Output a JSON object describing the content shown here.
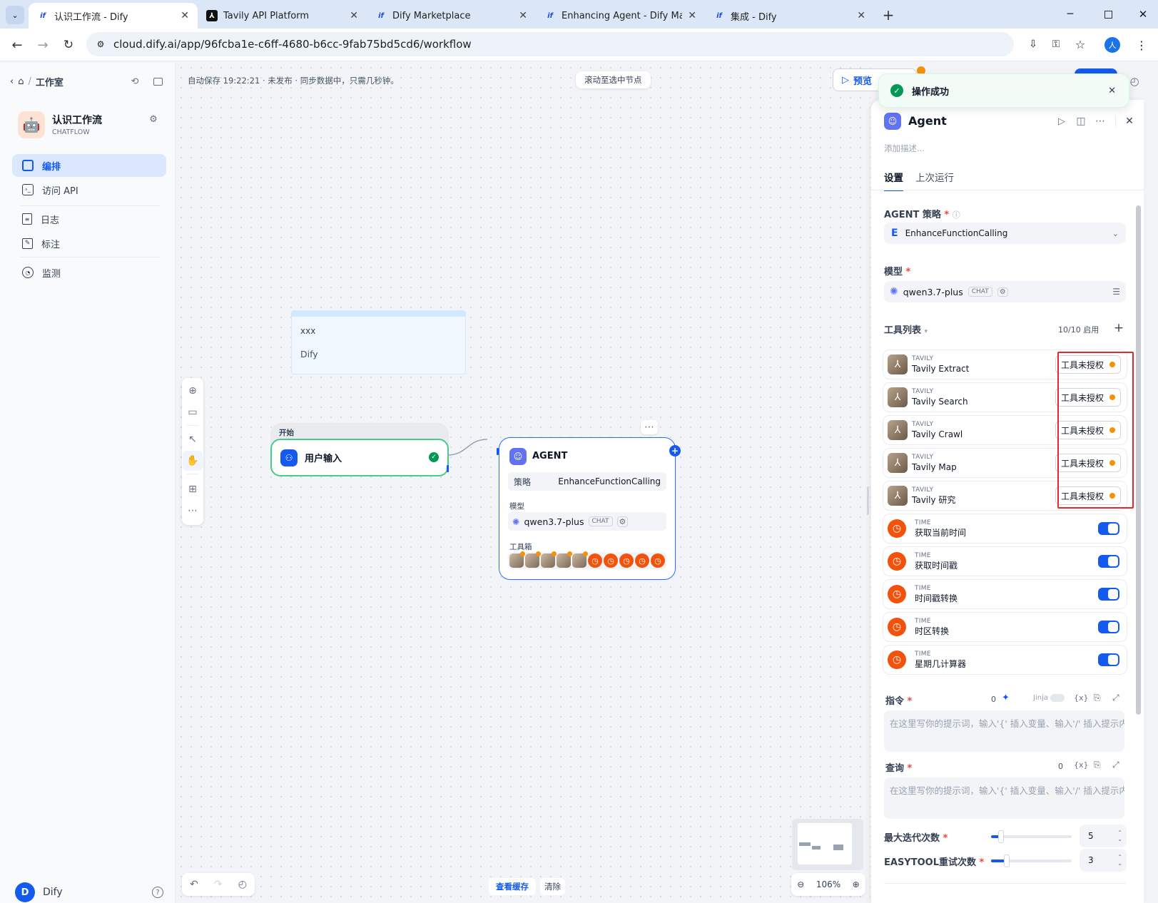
{
  "browser": {
    "tabs": [
      {
        "title": "认识工作流 - Dify",
        "favicon": "dify-icon"
      },
      {
        "title": "Tavily API Platform",
        "favicon": "tavily-icon"
      },
      {
        "title": "Dify Marketplace",
        "favicon": "dify-icon"
      },
      {
        "title": "Enhancing Agent - Dify Mark",
        "favicon": "dify-icon"
      },
      {
        "title": "集成 - Dify",
        "favicon": "dify-icon"
      }
    ],
    "url": "cloud.dify.ai/app/96fcba1e-c6ff-4680-b6cc-9fab75bd5cd6/workflow",
    "profile_initial": "人"
  },
  "sidebar": {
    "breadcrumb": "工作室",
    "app_name": "认识工作流",
    "app_type": "CHATFLOW",
    "nav": [
      {
        "label": "编排",
        "icon": "orchestrate-icon"
      },
      {
        "label": "访问 API",
        "icon": "terminal-icon"
      },
      {
        "label": "日志",
        "icon": "log-icon"
      },
      {
        "label": "标注",
        "icon": "annotation-icon"
      },
      {
        "label": "监测",
        "icon": "monitor-icon"
      }
    ],
    "user_initial": "D",
    "user_name": "Dify"
  },
  "canvas": {
    "status": "自动保存 19:22:21 · 未发布 · 同步数据中，只需几秒钟。",
    "scroll_btn": "滚动至选中节点",
    "preview_btn": "预览",
    "note": {
      "line1": "xxx",
      "line2": "Dify"
    },
    "start_node": {
      "header": "开始",
      "title": "用户输入"
    },
    "agent_node": {
      "title": "AGENT",
      "strategy_label": "策略",
      "strategy_value": "EnhanceFunctionCalling",
      "model_label": "模型",
      "model_value": "qwen3.7-plus",
      "model_badge": "CHAT",
      "tools_label": "工具箱"
    },
    "bottom": {
      "view_cache": "查看缓存",
      "clear": "清除",
      "zoom": "106%"
    }
  },
  "toast": {
    "text": "操作成功"
  },
  "panel": {
    "title": "Agent",
    "desc_placeholder": "添加描述...",
    "tabs": [
      "设置",
      "上次运行"
    ],
    "strategy_label": "AGENT 策略",
    "strategy_value": "EnhanceFunctionCalling",
    "strategy_letter": "E",
    "model_label": "模型",
    "model_value": "qwen3.7-plus",
    "model_badge": "CHAT",
    "tools_label": "工具列表",
    "tools_count": "10/10 启用",
    "tools": [
      {
        "provider": "TAVILY",
        "name": "Tavily Extract",
        "status": "工具未授权"
      },
      {
        "provider": "TAVILY",
        "name": "Tavily Search",
        "status": "工具未授权"
      },
      {
        "provider": "TAVILY",
        "name": "Tavily Crawl",
        "status": "工具未授权"
      },
      {
        "provider": "TAVILY",
        "name": "Tavily Map",
        "status": "工具未授权"
      },
      {
        "provider": "TAVILY",
        "name": "Tavily 研究",
        "status": "工具未授权"
      },
      {
        "provider": "TIME",
        "name": "获取当前时间",
        "enabled": true
      },
      {
        "provider": "TIME",
        "name": "获取时间戳",
        "enabled": true
      },
      {
        "provider": "TIME",
        "name": "时间戳转换",
        "enabled": true
      },
      {
        "provider": "TIME",
        "name": "时区转换",
        "enabled": true
      },
      {
        "provider": "TIME",
        "name": "星期几计算器",
        "enabled": true
      }
    ],
    "instruction_label": "指令",
    "instruction_count": "0",
    "jinja": "Jinja",
    "instruction_placeholder": "在这里写你的提示词，输入'{' 插入变量、输入'/' 插入提示内容块",
    "query_label": "查询",
    "query_count": "0",
    "query_placeholder": "在这里写你的提示词，输入'{' 插入变量、输入'/' 插入提示内容块",
    "max_iter_label": "最大迭代次数",
    "max_iter_value": "5",
    "retry_label": "EASYTOOL重试次数",
    "retry_value": "3",
    "var_icon": "{x}"
  },
  "colors": {
    "accent": "#155aef",
    "tool_orange": "#f2520b",
    "warn": "#f79009",
    "highlight": "#e5282b",
    "success": "#039855"
  }
}
